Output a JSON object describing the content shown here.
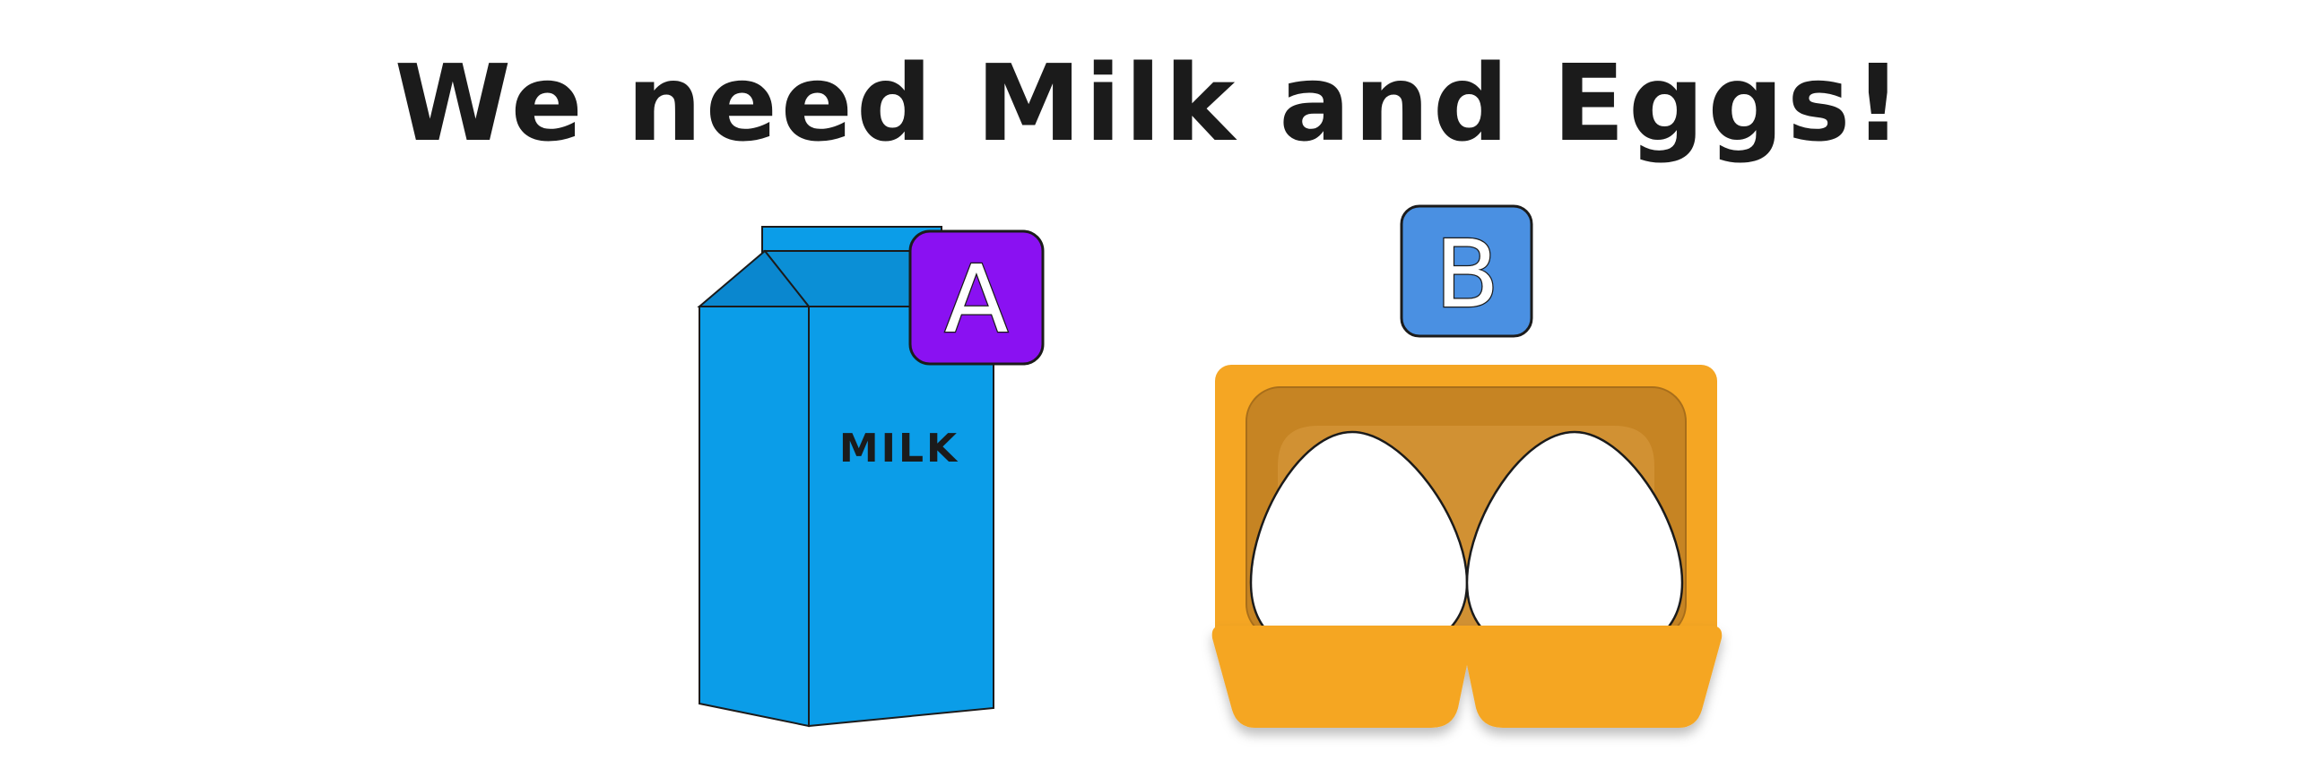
{
  "title": "We need Milk and Eggs!",
  "milk": {
    "carton_text": "MILK",
    "badge_letter": "A",
    "badge_color": "#8a11f2",
    "carton_color": "#0b9de8"
  },
  "eggs": {
    "badge_letter": "B",
    "badge_color": "#4a90e2",
    "carton_color": "#f5a623",
    "egg_count": 2
  }
}
